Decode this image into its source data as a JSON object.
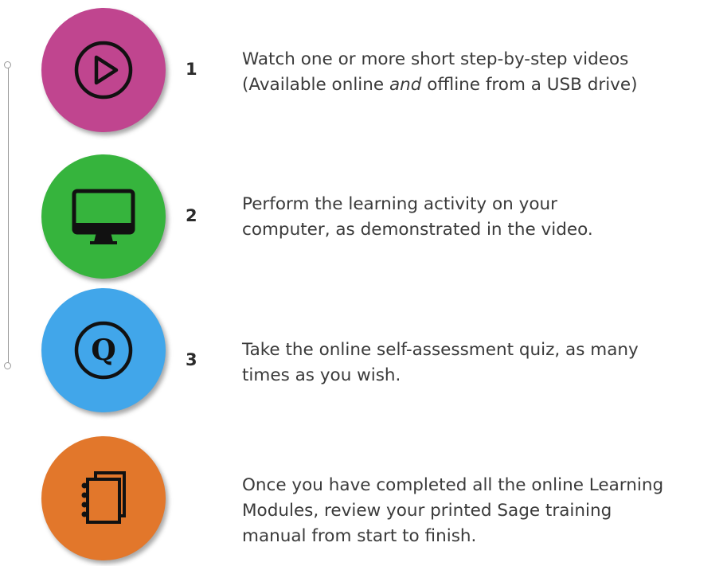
{
  "colors": {
    "step1": "#c0458f",
    "step2": "#36b43d",
    "step3": "#41a6ea",
    "step4": "#e2772b"
  },
  "steps": [
    {
      "number": "1",
      "icon": "play-icon",
      "line1": "Watch one or more short step-by-step videos",
      "line2_before": "(Available online ",
      "line2_em": "and",
      "line2_after": " offline from a USB drive)"
    },
    {
      "number": "2",
      "icon": "monitor-icon",
      "line1": "Perform the learning activity on your",
      "line2": "computer, as demonstrated in the video."
    },
    {
      "number": "3",
      "icon": "quiz-q-icon",
      "icon_letter": "Q",
      "line1": "Take the online self-assessment quiz, as many",
      "line2": "times as you wish."
    },
    {
      "icon": "notebook-icon",
      "line1": "Once you have completed all the online Learning",
      "line2": "Modules, review your printed Sage training",
      "line3": "manual from start to finish."
    }
  ]
}
